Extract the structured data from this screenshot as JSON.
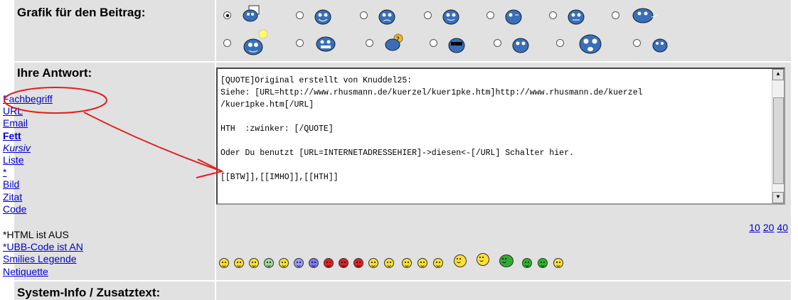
{
  "grafik": {
    "label": "Grafik für den Beitrag:"
  },
  "antwort": {
    "label": "Ihre Antwort:",
    "links": [
      "Fachbegriff",
      "URL",
      "Email",
      "Fett",
      "Kursiv",
      "Liste",
      "*",
      "Bild",
      "Zitat",
      "Code"
    ],
    "text": "[QUOTE]Original erstellt von Knuddel25:\nSiehe: [URL=http://www.rhusmann.de/kuerzel/kuer1pke.htm]http://www.rhusmann.de/kuerzel\n/kuer1pke.htm[/URL]\n\nHTH  :zwinker: [/QUOTE]\n\nOder Du benutzt [URL=INTERNETADRESSEHIER]->diesen<-[/URL] Schalter hier.\n\n[[BTW]],[[IMHO]],[[HTH]]"
  },
  "info": {
    "html": "*HTML ist AUS",
    "ubb": "*UBB-Code ist AN",
    "smilies": "Smilies Legende",
    "netiquette": "Netiquette"
  },
  "pages": [
    "10",
    "20",
    "40"
  ],
  "sysinfo": {
    "label": "System-Info / Zusatztext:"
  },
  "colors": {
    "cell_bg": "#e1e1e1",
    "link": "#0000cc",
    "annotation": "#e02020"
  }
}
